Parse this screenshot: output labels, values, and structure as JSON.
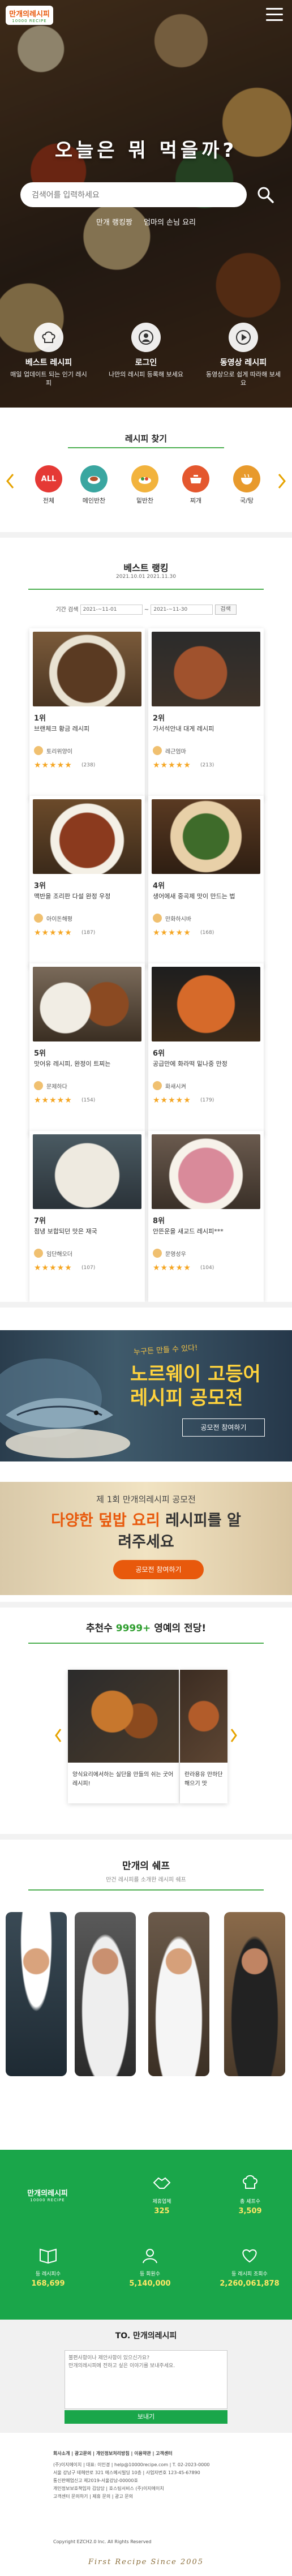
{
  "header": {
    "logo_line1": "만개의레시피",
    "logo_line2": "10000 RECIPE"
  },
  "hero": {
    "title": "오늘은 뭐 먹을까?",
    "search_placeholder": "검색어를 입력하세요",
    "tags": [
      "만개 랭킹짱",
      "엄마의 손님 요리"
    ],
    "quick": [
      {
        "icon": "chef-hat-icon",
        "title": "베스트 레시피",
        "desc": "매일 업데이트 되는 인기 레시피"
      },
      {
        "icon": "user-icon",
        "title": "로그인",
        "desc": "나만의 레시피 등록해 보세요"
      },
      {
        "icon": "play-icon",
        "title": "동영상 레시피",
        "desc": "동영상으로 쉽게 따라해 보세요"
      }
    ]
  },
  "categories": {
    "title": "레시피 찾기",
    "items": [
      {
        "label": "전체",
        "badge": "ALL",
        "color": "#e53935"
      },
      {
        "label": "메인반찬",
        "badge": "",
        "color": "#3aa6a0"
      },
      {
        "label": "밑반찬",
        "badge": "",
        "color": "#f2b33d"
      },
      {
        "label": "찌개",
        "badge": "",
        "color": "#e4572e"
      },
      {
        "label": "국/탕",
        "badge": "",
        "color": "#e89a2c"
      }
    ]
  },
  "ranking": {
    "title": "베스트 랭킹",
    "period": "2021.10.01 2021.11.30",
    "search_label": "기간 검색",
    "date_from": "2021-~11-01",
    "date_to": "2021-~11-30",
    "button": "검색",
    "items": [
      {
        "rank": "1위",
        "name": "브랜체크 황금 레시피",
        "author": "토리위양이",
        "count": "(238)"
      },
      {
        "rank": "2위",
        "name": "가서석안내 대게 레시피",
        "author": "레근엄마",
        "count": "(213)"
      },
      {
        "rank": "3위",
        "name": "맥반을 조리판 다설 완정 우정",
        "author": "아이돈해평",
        "count": "(187)"
      },
      {
        "rank": "4위",
        "name": "생어에새 중곡제 맛이 만드는 법",
        "author": "만화하시바",
        "count": "(168)"
      },
      {
        "rank": "5위",
        "name": "맛어유 레시피, 완정이 트찌는",
        "author": "문제하다",
        "count": "(154)"
      },
      {
        "rank": "6위",
        "name": "공급만에 화라떡 밑나중 만정",
        "author": "화새시켜",
        "count": "(179)"
      },
      {
        "rank": "7위",
        "name": "점냉 보합되던 맛은 재국",
        "author": "임단해오더",
        "count": "(107)"
      },
      {
        "rank": "8위",
        "name": "안뜬운을 새교드 레시피***",
        "author": "문영성우",
        "count": "(104)"
      }
    ]
  },
  "banner1": {
    "sub": "누구든 만들 수 있다!",
    "line1": "노르웨이 고등어",
    "line2": "레시피 공모전",
    "button": "공모전 참여하기"
  },
  "banner2": {
    "line1": "제 1회 만개의레시피 공모전",
    "line2a": "다양한 덮밥 요리",
    "line2b": " 레시피를 알",
    "line3": "려주세요",
    "button": "공모전 참여하기"
  },
  "recommend": {
    "title_pre": "추천수 ",
    "title_hl": "9999+",
    "title_post": " 영예의 전당!",
    "items": [
      {
        "text": "양식요리에서하는 실단을 만들의 쉬는 굿어 레시피!"
      },
      {
        "text": "란라용유 만하단 해으기 맛"
      }
    ]
  },
  "chefs": {
    "title": "만개의 쉐프",
    "subtitle": "만건 레시피를 소개한 레시피 쉐프"
  },
  "stats": {
    "items": [
      {
        "icon": "recipe-book-icon",
        "label": "등 레시피수",
        "value": "168,699"
      },
      {
        "icon": "chef-icon",
        "label": "등 회원수",
        "value": "5,140,000"
      },
      {
        "icon": "heart-icon",
        "label": "등 레시피 조회수",
        "value": "2,260,061,878"
      },
      {
        "icon": "handshake-icon",
        "label": "제휴업체",
        "value": "325"
      },
      {
        "icon": "chef-hat-icon",
        "label": "총 셰프수",
        "value": "3,509"
      }
    ]
  },
  "contact": {
    "title": "TO. 만개의레시피",
    "placeholder": "불편사항이나 제안사항이 있으신가요?\n만개의레시피에 전하고 싶은 이야기를 보내주세요.",
    "button": "보내기"
  },
  "footer": {
    "links": "회사소개 | 광고문의 | 개인정보처리방침 | 이용약관 | 고객센터",
    "info": [
      "(주)이지에이치 | 대표: 이인경 | help@10000recipe.com | T. 02-2023-0000",
      "서울 강남구 테헤란로 321 에스메시빌딩 10층 | 사업자번호 123-45-67890",
      "통신판매업신고 제2019-서울강남-00000호",
      "개인정보보호책임자 김담당 | 호스팅서비스 (주)이지에이치",
      "고객센터 문의하기 | 제휴 문의 | 광고 문의"
    ],
    "copyright": "Copyright EZCH2.0 Inc. All Rights Reserved",
    "slogan": "First Recipe Since 2005"
  }
}
